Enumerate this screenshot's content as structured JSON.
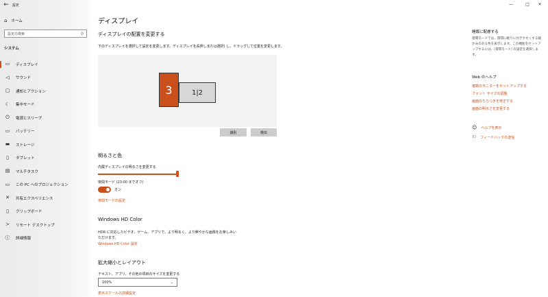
{
  "window": {
    "title": "設定",
    "min": "—",
    "max": "□",
    "close": "✕"
  },
  "sidebar": {
    "home_label": "ホーム",
    "search_placeholder": "設定の検索",
    "section": "システム",
    "items": [
      {
        "label": "ディスプレイ",
        "icon": "monitor-icon",
        "active": true
      },
      {
        "label": "サウンド",
        "icon": "speaker-icon"
      },
      {
        "label": "通知とアクション",
        "icon": "notification-icon"
      },
      {
        "label": "集中モード",
        "icon": "moon-icon"
      },
      {
        "label": "電源とスリープ",
        "icon": "power-icon"
      },
      {
        "label": "バッテリー",
        "icon": "battery-icon"
      },
      {
        "label": "ストレージ",
        "icon": "storage-icon"
      },
      {
        "label": "タブレット",
        "icon": "tablet-icon"
      },
      {
        "label": "マルチタスク",
        "icon": "multitask-icon"
      },
      {
        "label": "この PC へのプロジェクション",
        "icon": "projection-icon"
      },
      {
        "label": "共有エクスペリエンス",
        "icon": "share-icon"
      },
      {
        "label": "クリップボード",
        "icon": "clipboard-icon"
      },
      {
        "label": "リモート デスクトップ",
        "icon": "remote-icon"
      },
      {
        "label": "詳細情報",
        "icon": "info-icon"
      }
    ]
  },
  "main": {
    "title": "ディスプレイ",
    "arrange_title": "ディスプレイの配置を変更する",
    "arrange_desc": "下のディスプレイを選択して設定を変更します。ディスプレイを長押しまたは選択) し、ドラッグして位置を変更します。",
    "monitor_a": "3",
    "monitor_b": "1|2",
    "identify_button": "識別",
    "detect_button": "検出",
    "brightness_title": "明るさと色",
    "brightness_label": "内蔵ディスプレイの明るさを変更する",
    "brightness_value": 1.0,
    "nightlight_label": "夜間モード (23:00 までオフ)",
    "toggle_state": "オン",
    "nightlight_link": "夜間モードの設定",
    "hd_title": "Windows HD Color",
    "hd_desc": "HDR に対応したビデオ、ゲーム、アプリで、より明るく、より鮮やかな画像をお楽しみいただけます。",
    "hd_link": "Windows HD Color 設定",
    "scale_title": "拡大縮小とレイアウト",
    "scale_label": "テキスト、アプリ、その他の項目のサイズを変更する",
    "scale_value": "100%",
    "scale_link": "表示スケールの詳細設定"
  },
  "right": {
    "title": "睡眠に配慮する",
    "text": "夜間モードでは、夜間に眠りに付きやすくする暖かみのある色を表示します。この機能をセットアップするには、[夜間モード] の設定を選択します。",
    "web_help": "Web のヘルプ",
    "links": [
      "複数のモニターをセットアップする",
      "フォント サイズの調整",
      "画面のちらつきを修正する",
      "画面の明るさを変更する"
    ],
    "help_label": "ヘルプを表示",
    "feedback_label": "フィードバックの送信"
  },
  "colors": {
    "accent": "#c8501a"
  }
}
